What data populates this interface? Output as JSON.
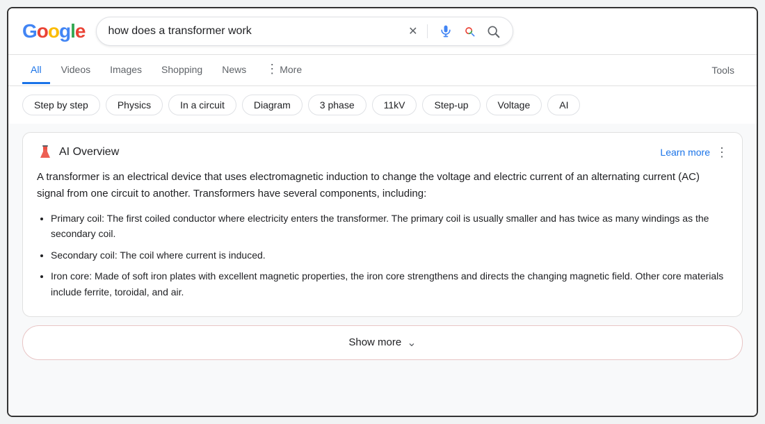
{
  "logo": {
    "letters": [
      {
        "char": "G",
        "color": "#4285F4"
      },
      {
        "char": "o",
        "color": "#EA4335"
      },
      {
        "char": "o",
        "color": "#FBBC05"
      },
      {
        "char": "g",
        "color": "#4285F4"
      },
      {
        "char": "l",
        "color": "#34A853"
      },
      {
        "char": "e",
        "color": "#EA4335"
      }
    ]
  },
  "search": {
    "query": "how does a transformer work",
    "placeholder": "Search"
  },
  "nav": {
    "tabs": [
      {
        "id": "all",
        "label": "All",
        "active": true
      },
      {
        "id": "videos",
        "label": "Videos",
        "active": false
      },
      {
        "id": "images",
        "label": "Images",
        "active": false
      },
      {
        "id": "shopping",
        "label": "Shopping",
        "active": false
      },
      {
        "id": "news",
        "label": "News",
        "active": false
      },
      {
        "id": "more",
        "label": "More",
        "active": false
      }
    ],
    "tools_label": "Tools"
  },
  "chips": [
    {
      "id": "step-by-step",
      "label": "Step by step"
    },
    {
      "id": "physics",
      "label": "Physics"
    },
    {
      "id": "in-a-circuit",
      "label": "In a circuit"
    },
    {
      "id": "diagram",
      "label": "Diagram"
    },
    {
      "id": "3-phase",
      "label": "3 phase"
    },
    {
      "id": "11kv",
      "label": "11kV"
    },
    {
      "id": "step-up",
      "label": "Step-up"
    },
    {
      "id": "voltage",
      "label": "Voltage"
    },
    {
      "id": "ai",
      "label": "AI"
    }
  ],
  "ai_overview": {
    "icon": "flask",
    "title": "AI Overview",
    "learn_more": "Learn more",
    "summary": "A transformer is an electrical device that uses electromagnetic induction to change the voltage and electric current of an alternating current (AC) signal from one circuit to another. Transformers have several components, including:",
    "bullets": [
      {
        "term": "Primary coil:",
        "definition": "The first coiled conductor where electricity enters the transformer. The primary coil is usually smaller and has twice as many windings as the secondary coil."
      },
      {
        "term": "Secondary coil:",
        "definition": "The coil where current is induced."
      },
      {
        "term": "Iron core:",
        "definition": "Made of soft iron plates with excellent magnetic properties, the iron core strengthens and directs the changing magnetic field. Other core materials include ferrite, toroidal, and air."
      }
    ],
    "show_more": "Show more"
  }
}
